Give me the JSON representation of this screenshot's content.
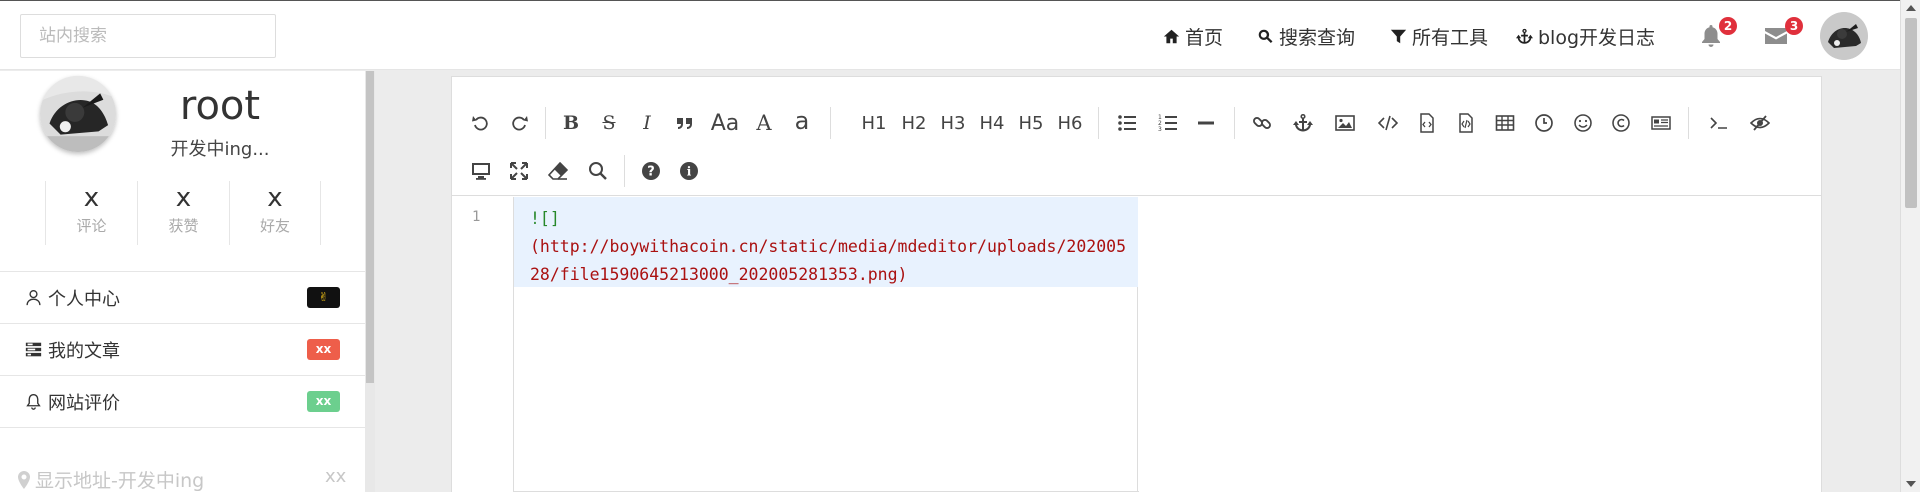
{
  "search": {
    "placeholder": "站内搜索"
  },
  "nav": {
    "home": "首页",
    "search": "搜索查询",
    "tools": "所有工具",
    "log": "blog开发日志"
  },
  "notifications": {
    "bell_count": "2",
    "mail_count": "3"
  },
  "profile": {
    "username": "root",
    "tagline": "开发中ing...",
    "stats": [
      {
        "value": "x",
        "label": "评论"
      },
      {
        "value": "x",
        "label": "获赞"
      },
      {
        "value": "x",
        "label": "好友"
      }
    ]
  },
  "menu": [
    {
      "label": "个人中心",
      "badge": "✌",
      "badge_color": "#111111",
      "icon": "user-icon"
    },
    {
      "label": "我的文章",
      "badge": "xx",
      "badge_color": "#ee5e4a",
      "icon": "tasks-icon"
    },
    {
      "label": "网站评价",
      "badge": "xx",
      "badge_color": "#6ccf8e",
      "icon": "bell-icon"
    }
  ],
  "location": {
    "label": "显示地址-开发中ing",
    "value": "xx"
  },
  "editor": {
    "toolbar_text": {
      "font_size": "Aa",
      "uppercase": "A",
      "lowercase": "a",
      "h1": "H1",
      "h2": "H2",
      "h3": "H3",
      "h4": "H4",
      "h5": "H5",
      "h6": "H6"
    },
    "line_number": "1",
    "code_prefix": "![]",
    "code_url": "(http://boywithacoin.cn/static/media/mdeditor/uploads/20200528/file1590645213000_202005281353.png)"
  }
}
